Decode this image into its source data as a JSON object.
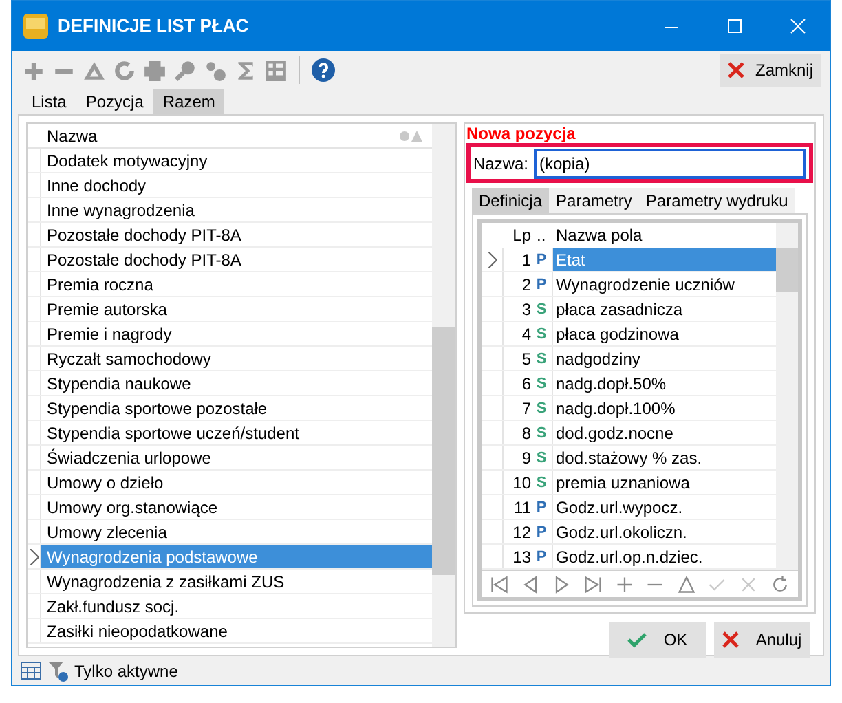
{
  "window": {
    "title": "DEFINICJE LIST PŁAC"
  },
  "toolbar": {
    "close_button": "Zamknij"
  },
  "tabs": [
    {
      "label": "Lista",
      "selected": false
    },
    {
      "label": "Pozycja",
      "selected": false
    },
    {
      "label": "Razem",
      "selected": true
    }
  ],
  "list": {
    "column": "Nazwa",
    "items": [
      {
        "name": "Dodatek motywacyjny",
        "selected": false
      },
      {
        "name": "Inne dochody",
        "selected": false
      },
      {
        "name": "Inne wynagrodzenia",
        "selected": false
      },
      {
        "name": "Pozostałe dochody PIT-8A",
        "selected": false
      },
      {
        "name": "Pozostałe dochody PIT-8A",
        "selected": false
      },
      {
        "name": "Premia roczna",
        "selected": false
      },
      {
        "name": "Premie autorska",
        "selected": false
      },
      {
        "name": "Premie i nagrody",
        "selected": false
      },
      {
        "name": "Ryczałt samochodowy",
        "selected": false
      },
      {
        "name": "Stypendia naukowe",
        "selected": false
      },
      {
        "name": "Stypendia sportowe pozostałe",
        "selected": false
      },
      {
        "name": "Stypendia sportowe uczeń/student",
        "selected": false
      },
      {
        "name": "Świadczenia urlopowe",
        "selected": false
      },
      {
        "name": "Umowy o dzieło",
        "selected": false
      },
      {
        "name": "Umowy org.stanowiące",
        "selected": false
      },
      {
        "name": "Umowy zlecenia",
        "selected": false
      },
      {
        "name": "Wynagrodzenia podstawowe",
        "selected": true
      },
      {
        "name": "Wynagrodzenia z zasiłkami ZUS",
        "selected": false
      },
      {
        "name": "Zakł.fundusz socj.",
        "selected": false
      },
      {
        "name": "Zasiłki nieopodatkowane",
        "selected": false
      }
    ]
  },
  "form": {
    "title": "Nowa pozycja",
    "name_label": "Nazwa:",
    "name_value": "(kopia)",
    "subtabs": [
      {
        "label": "Definicja",
        "selected": true
      },
      {
        "label": "Parametry",
        "selected": false
      },
      {
        "label": "Parametry wydruku",
        "selected": false
      }
    ],
    "grid": {
      "columns": [
        "Lp",
        "..",
        "Nazwa pola"
      ],
      "rows": [
        {
          "lp": "1",
          "kind": "P",
          "name": "Etat",
          "selected": true
        },
        {
          "lp": "2",
          "kind": "P",
          "name": "Wynagrodzenie uczniów",
          "selected": false
        },
        {
          "lp": "3",
          "kind": "S",
          "name": "płaca zasadnicza",
          "selected": false
        },
        {
          "lp": "4",
          "kind": "S",
          "name": "płaca godzinowa",
          "selected": false
        },
        {
          "lp": "5",
          "kind": "S",
          "name": "nadgodziny",
          "selected": false
        },
        {
          "lp": "6",
          "kind": "S",
          "name": "nadg.dopł.50%",
          "selected": false
        },
        {
          "lp": "7",
          "kind": "S",
          "name": "nadg.dopł.100%",
          "selected": false
        },
        {
          "lp": "8",
          "kind": "S",
          "name": "dod.godz.nocne",
          "selected": false
        },
        {
          "lp": "9",
          "kind": "S",
          "name": "dod.stażowy % zas.",
          "selected": false
        },
        {
          "lp": "10",
          "kind": "S",
          "name": "premia uznaniowa",
          "selected": false
        },
        {
          "lp": "11",
          "kind": "P",
          "name": "Godz.url.wypocz.",
          "selected": false
        },
        {
          "lp": "12",
          "kind": "P",
          "name": "Godz.url.okoliczn.",
          "selected": false
        },
        {
          "lp": "13",
          "kind": "P",
          "name": "Godz.url.op.n.dziec.",
          "selected": false
        }
      ]
    },
    "buttons": [
      {
        "kind": "ok",
        "label": "OK"
      },
      {
        "kind": "cancel",
        "label": "Anuluj"
      }
    ]
  },
  "status_bar": {
    "filter": "Tylko aktywne"
  }
}
